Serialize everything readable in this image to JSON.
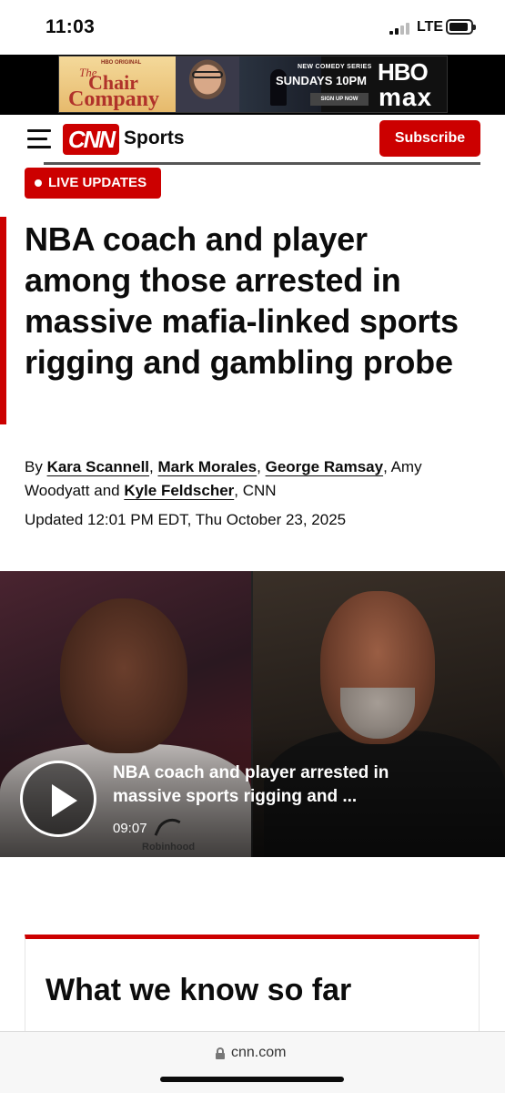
{
  "status_bar": {
    "time": "11:03",
    "network": "LTE",
    "icons": [
      "signal-icon",
      "battery-icon"
    ]
  },
  "ad": {
    "brand_top": "HBO ORIGINAL",
    "title_line1": "The",
    "title_line2": "Chair",
    "title_line3": "Company",
    "tagline": "NEW COMEDY SERIES",
    "schedule": "SUNDAYS 10PM",
    "cta": "SIGN UP NOW",
    "network_line1": "HBO",
    "network_line2": "max"
  },
  "header": {
    "logo_text": "CNN",
    "section": "Sports",
    "subscribe_label": "Subscribe",
    "icons": [
      "menu-icon"
    ],
    "accent_color": "#cc0000"
  },
  "article": {
    "badge": "LIVE UPDATES",
    "headline": "NBA coach and player among those arrested in massive mafia-linked sports rigging and gambling probe",
    "byline": {
      "prefix": "By",
      "authors": [
        "Kara Scannell",
        "Mark Morales",
        "George Ramsay",
        "Amy Woodyatt",
        "Kyle Feldscher"
      ],
      "suffix": "CNN"
    },
    "updated": "Updated 12:01 PM EDT, Thu October 23, 2025"
  },
  "video": {
    "title": "NBA coach and player arrested in massive sports rigging and ...",
    "duration": "09:07",
    "sponsor": "Robinhood",
    "icons": [
      "play-icon",
      "robinhood-feather-icon"
    ]
  },
  "what_we_know": {
    "title": "What we know so far"
  },
  "browser": {
    "url": "cnn.com",
    "icons": [
      "lock-icon"
    ]
  }
}
